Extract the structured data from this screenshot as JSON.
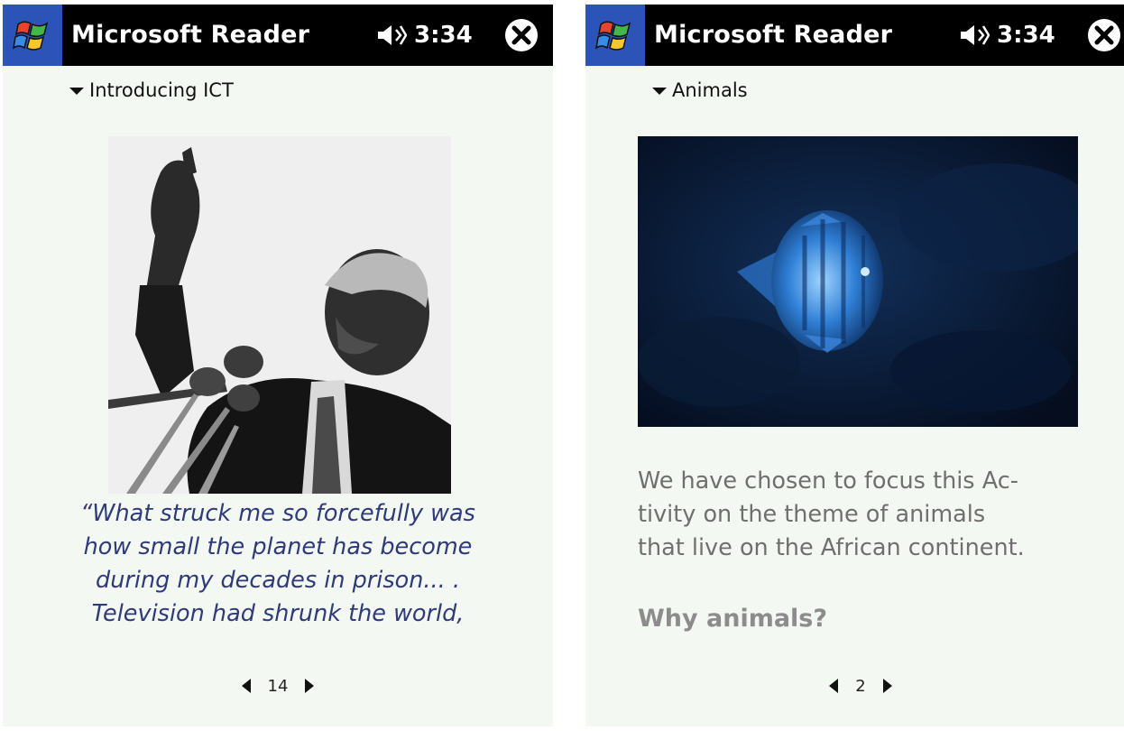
{
  "screens": [
    {
      "app_title": "Microsoft Reader",
      "clock": "3:34",
      "section_title": "Introducing ICT",
      "page_number": "14",
      "photo_icon": "person-speaking-photo",
      "quote_lines": [
        "“What struck me so forcefully was",
        "how small the planet has become",
        "during my decades in prison... .",
        "Television had shrunk the world,"
      ]
    },
    {
      "app_title": "Microsoft Reader",
      "clock": "3:34",
      "section_title": "Animals",
      "page_number": "2",
      "photo_icon": "fish-underwater-photo",
      "body_lines": [
        "We have chosen to focus this Ac-",
        "tivity on the theme of animals",
        "that live on the African continent."
      ],
      "subheading": "Why animals?"
    }
  ],
  "colors": {
    "titlebar": "#000000",
    "start_button": "#2c53b8",
    "page_background": "#f4f8f2",
    "quote_text": "#2f3a78",
    "body_text": "#6f6f6f",
    "subheading_text": "#8c8c8c"
  }
}
